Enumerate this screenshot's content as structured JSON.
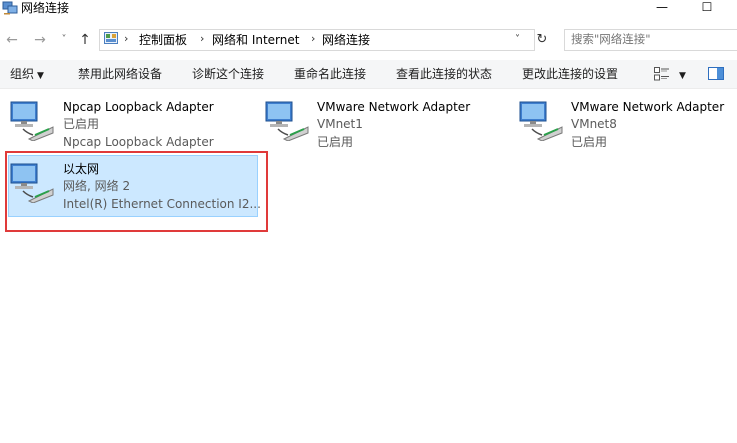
{
  "window": {
    "title": "网络连接",
    "minimize": "—",
    "maximize": "☐"
  },
  "nav": {
    "back": "←",
    "forward": "→",
    "recent": "˅",
    "up": "↑"
  },
  "address": {
    "crumbs": [
      "控制面板",
      "网络和 Internet",
      "网络连接"
    ],
    "separator": "›",
    "dropdown": "˅",
    "refresh": "↻"
  },
  "search": {
    "placeholder": "搜索\"网络连接\""
  },
  "commands": {
    "organize": "组织",
    "disable": "禁用此网络设备",
    "diagnose": "诊断这个连接",
    "rename": "重命名此连接",
    "status": "查看此连接的状态",
    "settings": "更改此连接的设置"
  },
  "connections": [
    {
      "name": "Npcap Loopback Adapter",
      "status": "已启用",
      "device": "Npcap Loopback Adapter",
      "selected": false
    },
    {
      "name": "VMware Network Adapter",
      "status": "VMnet1",
      "device": "已启用",
      "selected": false
    },
    {
      "name": "VMware Network Adapter",
      "status": "VMnet8",
      "device": "已启用",
      "selected": false
    },
    {
      "name": "以太网",
      "status": "网络, 网络 2",
      "device": "Intel(R) Ethernet Connection I2...",
      "selected": true
    }
  ],
  "colors": {
    "selection": "#cce8ff",
    "selection_border": "#99d1ff",
    "annotation": "#e03a3a"
  },
  "icons": [
    "network-adapter-icon",
    "control-panel-icon",
    "view-options-icon",
    "preview-pane-icon"
  ]
}
